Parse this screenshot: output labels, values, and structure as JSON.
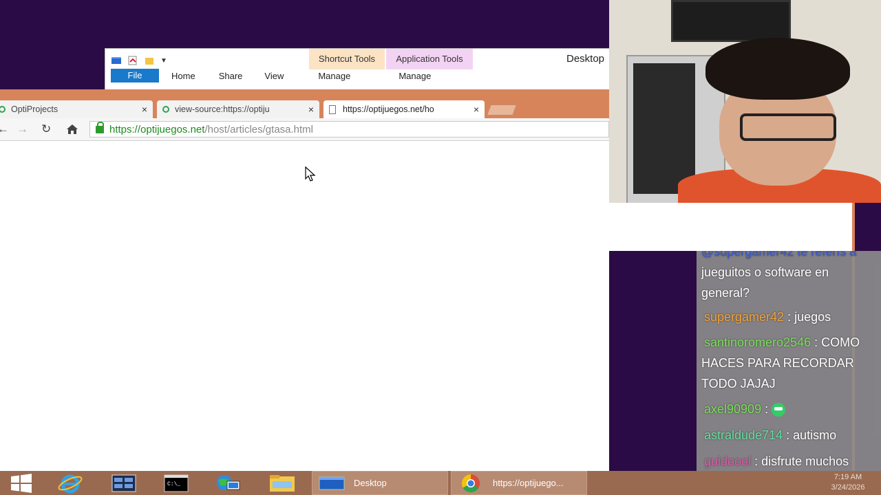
{
  "explorer": {
    "title": "Desktop",
    "context_tabs": [
      "Shortcut Tools",
      "Application Tools"
    ],
    "ribbon_tabs": [
      "File",
      "Home",
      "Share",
      "View",
      "Manage",
      "Manage"
    ]
  },
  "chrome": {
    "tabs": [
      {
        "label": "OptiProjects",
        "close": "×"
      },
      {
        "label": "view-source:https://optiju",
        "close": "×"
      },
      {
        "label": "https://optijuegos.net/ho",
        "close": "×"
      }
    ],
    "url_host": "https://optijuegos.net",
    "url_path": "/host/articles/gtasa.html"
  },
  "chat": {
    "partial_top": "@supergamer42 te referís a",
    "messages": [
      {
        "user": "",
        "text": "jueguitos o software en general?",
        "color": "#ffffff"
      },
      {
        "user": "supergamer42",
        "text": ": juegos",
        "color": "#f2a43a"
      },
      {
        "user": "santinoromero2546",
        "text": ": COMO HACES PARA RECORDAR TODO JAJAJ",
        "color": "#7be05a"
      },
      {
        "user": "axel90909",
        "text": ":",
        "color": "#7be05a"
      },
      {
        "user": "astraldude714",
        "text": ": autismo",
        "color": "#63e0a0"
      },
      {
        "user": "guidoool",
        "text": ": disfrute muchos juegos gracias a vos",
        "color": "#e05aa8"
      }
    ]
  },
  "taskbar": {
    "tasks": [
      {
        "label": "Desktop"
      },
      {
        "label": "https://optijuego..."
      }
    ],
    "time": "7:19 AM",
    "date": "3/24/2026"
  },
  "colors": {
    "desktop": "#2b0b46",
    "chrome_frame": "#d8845b",
    "taskbar": "#9a6a50"
  }
}
